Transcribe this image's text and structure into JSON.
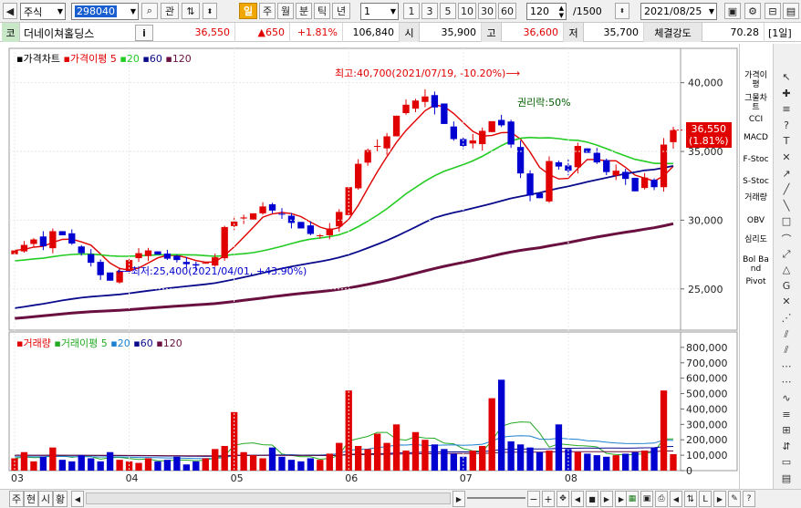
{
  "toolbar": {
    "market": "주식",
    "code": "298040",
    "search_label": "관",
    "period_active": "일",
    "periods": [
      "주",
      "월",
      "분",
      "틱",
      "년"
    ],
    "unit_value": "1",
    "quick_counts": [
      "1",
      "3",
      "5",
      "10",
      "30",
      "60"
    ],
    "bar_count": "120",
    "total_count": "/1500",
    "date": "2021/08/25"
  },
  "quote": {
    "market_tag": "코",
    "name": "더네이쳐홀딩스",
    "info_label": "i",
    "price": "36,550",
    "change": "▲650",
    "change_pct": "+1.81%",
    "volume": "106,840",
    "open_label": "시",
    "open": "35,900",
    "high_label": "고",
    "high": "36,600",
    "low_label": "저",
    "low": "35,700",
    "strength_label": "체결강도",
    "strength": "70.28",
    "period_tag": "[1일]"
  },
  "price_panel": {
    "legend_title": "가격차트",
    "legend_ma_label": "가격이평",
    "legend_ma": [
      "5",
      "20",
      "60",
      "120"
    ],
    "y_ticks": [
      "40,000",
      "35,000",
      "30,000",
      "25,000"
    ],
    "current_price": "36,550",
    "current_pct": "(1.81%)",
    "high_note": "최고:40,700(2021/07/19, -10.20%)⟶",
    "low_note": "⟵최저:25,400(2021/04/01, +43.90%)",
    "event_note": "권리락:50%"
  },
  "volume_panel": {
    "legend_title": "거래량",
    "legend_ma_label": "거래이평",
    "legend_ma": [
      "5",
      "20",
      "60",
      "120"
    ],
    "y_ticks": [
      "800,000",
      "700,000",
      "600,000",
      "500,000",
      "400,000",
      "300,000",
      "200,000",
      "100,000",
      "0"
    ]
  },
  "x_ticks": [
    "03",
    "04",
    "05",
    "06",
    "07",
    "08"
  ],
  "bottom_tabs": [
    "주",
    "현",
    "시",
    "황"
  ],
  "side_indicators": [
    "가격이평",
    "그물차트",
    "CCI",
    "MACD",
    "F-Stoc",
    "S-Stoc",
    "거래량",
    "OBV",
    "심리도",
    "Bol Band",
    "Pivot"
  ],
  "colors": {
    "up": "#e00000",
    "down": "#0000d0",
    "ma5": "#e00000",
    "ma20": "#22cc22",
    "ma60": "#0a0a8c",
    "ma120": "#6a1040"
  },
  "chart_data": {
    "type": "candlestick",
    "x_range": [
      "2021-03-01",
      "2021-08-25"
    ],
    "price_ylim": [
      22000,
      42500
    ],
    "volume_ylim": [
      0,
      900000
    ],
    "series": [
      {
        "name": "가격(종가 근사)",
        "values": [
          27800,
          28200,
          28600,
          28100,
          29200,
          28900,
          28300,
          27600,
          26900,
          26000,
          25600,
          26300,
          27100,
          27600,
          27800,
          27500,
          27200,
          27100,
          26800,
          26700,
          26900,
          27300,
          29500,
          29900,
          30200,
          30500,
          31000,
          30700,
          30400,
          29800,
          29400,
          29000,
          28900,
          29400,
          30600,
          32400,
          34100,
          35100,
          35400,
          36100,
          37600,
          38400,
          38700,
          39000,
          38200,
          37000,
          35900,
          35400,
          35800,
          36500,
          37200,
          36900,
          35500,
          33400,
          31800,
          31600,
          34300,
          33900,
          33600,
          35400,
          34900,
          34200,
          33500,
          33600,
          33000,
          32100,
          33100,
          32400,
          35500,
          36550
        ]
      },
      {
        "name": "거래량",
        "values": [
          80000,
          120000,
          60000,
          90000,
          150000,
          70000,
          60000,
          100000,
          80000,
          60000,
          120000,
          70000,
          60000,
          50000,
          80000,
          60000,
          70000,
          90000,
          40000,
          60000,
          80000,
          140000,
          160000,
          380000,
          120000,
          100000,
          80000,
          150000,
          90000,
          70000,
          60000,
          80000,
          70000,
          110000,
          180000,
          520000,
          160000,
          140000,
          240000,
          180000,
          300000,
          130000,
          250000,
          200000,
          170000,
          140000,
          110000,
          90000,
          130000,
          160000,
          470000,
          590000,
          190000,
          170000,
          150000,
          120000,
          130000,
          300000,
          140000,
          120000,
          110000,
          100000,
          90000,
          100000,
          110000,
          120000,
          130000,
          150000,
          520000,
          106840
        ]
      }
    ]
  }
}
